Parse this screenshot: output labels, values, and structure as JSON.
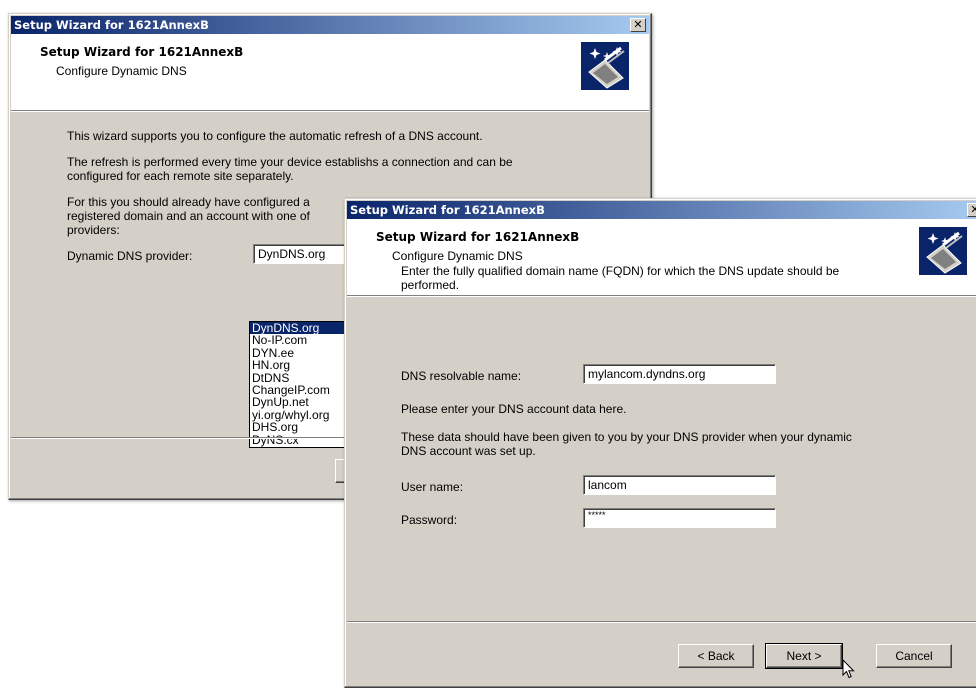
{
  "back_window": {
    "title": "Setup Wizard for 1621AnnexB",
    "header_title": "Setup Wizard for 1621AnnexB",
    "header_subtitle": "Configure Dynamic DNS",
    "paragraph1": "This wizard supports you to configure the automatic refresh of a DNS account.",
    "paragraph2_line1": "The refresh is performed every time your device establishs a connection and can be",
    "paragraph2_line2": "configured for each remote site separately.",
    "paragraph3_line1": "For this you should already have configured a",
    "paragraph3_line2": "registered domain and an account with one of",
    "paragraph3_line3": "providers:",
    "provider_label": "Dynamic DNS provider:",
    "provider_value": "DynDNS.org",
    "provider_options": [
      "DynDNS.org",
      "No-IP.com",
      "DYN.ee",
      "HN.org",
      "DtDNS",
      "ChangeIP.com",
      "DynUp.net",
      "yi.org/whyl.org",
      "DHS.org",
      "DyNS.cx"
    ]
  },
  "front_window": {
    "title": "Setup Wizard for 1621AnnexB",
    "header_title": "Setup Wizard for 1621AnnexB",
    "header_subtitle": "Configure Dynamic DNS",
    "fqdn_line1": "Enter the fully qualified domain name (FQDN) for which the DNS update should be",
    "fqdn_line2": "performed.",
    "dns_name_label": "DNS resolvable name:",
    "dns_name_value": "mylancom.dyndns.org",
    "account_prompt": "Please enter your DNS account data here.",
    "account_info_line1": "These data should have been given to you by your DNS provider when your dynamic",
    "account_info_line2": "DNS account was set up.",
    "username_label": "User name:",
    "username_value": "lancom",
    "password_label": "Password:",
    "password_value": "*****",
    "back_button": "< Back",
    "next_button": "Next >",
    "cancel_button": "Cancel"
  },
  "icons": {
    "close": "close-icon",
    "wizard": "wizard-wand-icon",
    "cursor": "mouse-pointer-icon"
  },
  "colors": {
    "titlebar_start": "#0a246a",
    "titlebar_end": "#a6caf0",
    "dialog_bg": "#d4d0c8",
    "selection": "#0a246a"
  }
}
